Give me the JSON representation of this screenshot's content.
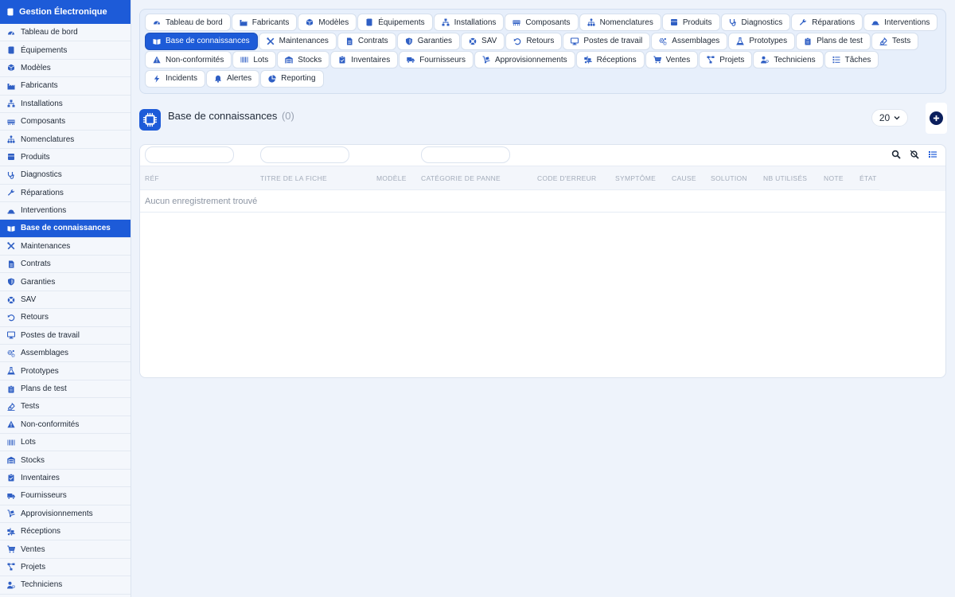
{
  "app": {
    "title": "Gestion Électronique"
  },
  "sidebar": {
    "items": [
      {
        "label": "Tableau de bord",
        "icon": "gauge-icon"
      },
      {
        "label": "Équipements",
        "icon": "book-icon"
      },
      {
        "label": "Modèles",
        "icon": "cube-icon"
      },
      {
        "label": "Fabricants",
        "icon": "industry-icon"
      },
      {
        "label": "Installations",
        "icon": "sitemap-icon"
      },
      {
        "label": "Composants",
        "icon": "memory-icon"
      },
      {
        "label": "Nomenclatures",
        "icon": "hierarchy-icon"
      },
      {
        "label": "Produits",
        "icon": "box-icon"
      },
      {
        "label": "Diagnostics",
        "icon": "stethoscope-icon"
      },
      {
        "label": "Réparations",
        "icon": "wrench-icon"
      },
      {
        "label": "Interventions",
        "icon": "hardhat-icon"
      },
      {
        "label": "Base de connaissances",
        "icon": "open-book-icon",
        "active": true
      },
      {
        "label": "Maintenances",
        "icon": "tools-icon"
      },
      {
        "label": "Contrats",
        "icon": "file-icon"
      },
      {
        "label": "Garanties",
        "icon": "shield-icon"
      },
      {
        "label": "SAV",
        "icon": "lifebuoy-icon"
      },
      {
        "label": "Retours",
        "icon": "undo-icon"
      },
      {
        "label": "Postes de travail",
        "icon": "desktop-icon"
      },
      {
        "label": "Assemblages",
        "icon": "cogs-icon"
      },
      {
        "label": "Prototypes",
        "icon": "flask-icon"
      },
      {
        "label": "Plans de test",
        "icon": "clipboard-icon"
      },
      {
        "label": "Tests",
        "icon": "vial-icon"
      },
      {
        "label": "Non-conformités",
        "icon": "warning-icon"
      },
      {
        "label": "Lots",
        "icon": "barcode-icon"
      },
      {
        "label": "Stocks",
        "icon": "warehouse-icon"
      },
      {
        "label": "Inventaires",
        "icon": "clipboard-check-icon"
      },
      {
        "label": "Fournisseurs",
        "icon": "truck-icon"
      },
      {
        "label": "Approvisionnements",
        "icon": "dolly-icon"
      },
      {
        "label": "Réceptions",
        "icon": "truck-loading-icon"
      },
      {
        "label": "Ventes",
        "icon": "cart-icon"
      },
      {
        "label": "Projets",
        "icon": "project-diagram-icon"
      },
      {
        "label": "Techniciens",
        "icon": "users-cog-icon"
      }
    ]
  },
  "topnav": {
    "tabs": [
      {
        "label": "Tableau de bord",
        "icon": "gauge-icon"
      },
      {
        "label": "Fabricants",
        "icon": "industry-icon"
      },
      {
        "label": "Modèles",
        "icon": "cube-icon"
      },
      {
        "label": "Équipements",
        "icon": "book-icon"
      },
      {
        "label": "Installations",
        "icon": "sitemap-icon"
      },
      {
        "label": "Composants",
        "icon": "memory-icon"
      },
      {
        "label": "Nomenclatures",
        "icon": "hierarchy-icon"
      },
      {
        "label": "Produits",
        "icon": "box-icon"
      },
      {
        "label": "Diagnostics",
        "icon": "stethoscope-icon"
      },
      {
        "label": "Réparations",
        "icon": "wrench-icon"
      },
      {
        "label": "Interventions",
        "icon": "hardhat-icon"
      },
      {
        "label": "Base de connaissances",
        "icon": "open-book-icon",
        "active": true
      },
      {
        "label": "Maintenances",
        "icon": "tools-icon"
      },
      {
        "label": "Contrats",
        "icon": "file-icon"
      },
      {
        "label": "Garanties",
        "icon": "shield-icon"
      },
      {
        "label": "SAV",
        "icon": "lifebuoy-icon"
      },
      {
        "label": "Retours",
        "icon": "undo-icon"
      },
      {
        "label": "Postes de travail",
        "icon": "desktop-icon"
      },
      {
        "label": "Assemblages",
        "icon": "cogs-icon"
      },
      {
        "label": "Prototypes",
        "icon": "flask-icon"
      },
      {
        "label": "Plans de test",
        "icon": "clipboard-icon"
      },
      {
        "label": "Tests",
        "icon": "vial-icon"
      },
      {
        "label": "Non-conformités",
        "icon": "warning-icon"
      },
      {
        "label": "Lots",
        "icon": "barcode-icon"
      },
      {
        "label": "Stocks",
        "icon": "warehouse-icon"
      },
      {
        "label": "Inventaires",
        "icon": "clipboard-check-icon"
      },
      {
        "label": "Fournisseurs",
        "icon": "truck-icon"
      },
      {
        "label": "Approvisionnements",
        "icon": "dolly-icon"
      },
      {
        "label": "Réceptions",
        "icon": "truck-loading-icon"
      },
      {
        "label": "Ventes",
        "icon": "cart-icon"
      },
      {
        "label": "Projets",
        "icon": "project-diagram-icon"
      },
      {
        "label": "Techniciens",
        "icon": "users-cog-icon"
      },
      {
        "label": "Tâches",
        "icon": "tasks-icon"
      },
      {
        "label": "Incidents",
        "icon": "bolt-icon"
      },
      {
        "label": "Alertes",
        "icon": "bell-icon"
      },
      {
        "label": "Reporting",
        "icon": "pie-chart-icon"
      }
    ]
  },
  "page": {
    "title": "Base de connaissances",
    "count": "(0)",
    "per_page": "20"
  },
  "table": {
    "columns": [
      "Réf",
      "Titre de la fiche",
      "Modèle",
      "Catégorie de panne",
      "Code d'erreur",
      "Symptôme",
      "Cause",
      "Solution",
      "Nb utilisés",
      "Note",
      "État"
    ],
    "empty_message": "Aucun enregistrement trouvé",
    "filter_values": [
      "",
      "",
      ""
    ]
  },
  "colors": {
    "accent": "#1d5bd8",
    "add_button": "#0b1f5c",
    "background": "#eef3fb"
  }
}
